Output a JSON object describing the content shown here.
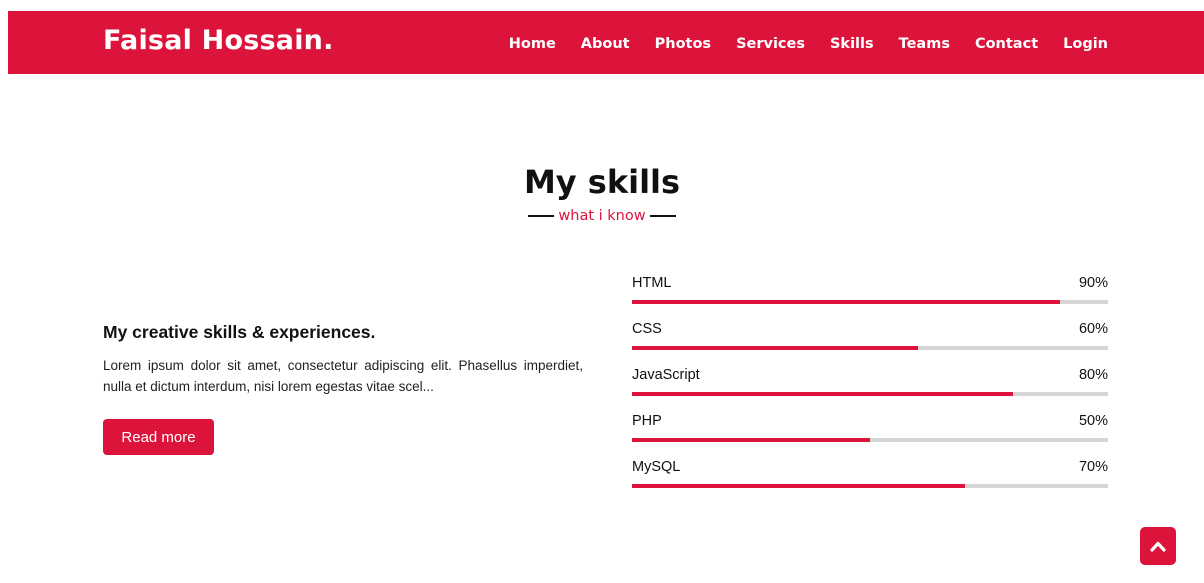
{
  "nav": {
    "logo": "Faisal Hossain.",
    "items": [
      "Home",
      "About",
      "Photos",
      "Services",
      "Skills",
      "Teams",
      "Contact",
      "Login"
    ]
  },
  "section": {
    "title": "My skills",
    "subtitle": "what i know"
  },
  "left": {
    "heading": "My creative skills & experiences.",
    "text": "Lorem ipsum dolor sit amet, consectetur adipiscing elit. Phasellus imperdiet, nulla et dictum interdum, nisi lorem egestas vitae scel...",
    "button": "Read more"
  },
  "skills": [
    {
      "name": "HTML",
      "percent": "90%",
      "value": 90
    },
    {
      "name": "CSS",
      "percent": "60%",
      "value": 60
    },
    {
      "name": "JavaScript",
      "percent": "80%",
      "value": 80
    },
    {
      "name": "PHP",
      "percent": "50%",
      "value": 50
    },
    {
      "name": "MySQL",
      "percent": "70%",
      "value": 70
    }
  ],
  "colors": {
    "accent": "#dc143c",
    "track": "#d6d6d6"
  },
  "icons": {
    "scroll_top": "chevron-up-icon"
  }
}
